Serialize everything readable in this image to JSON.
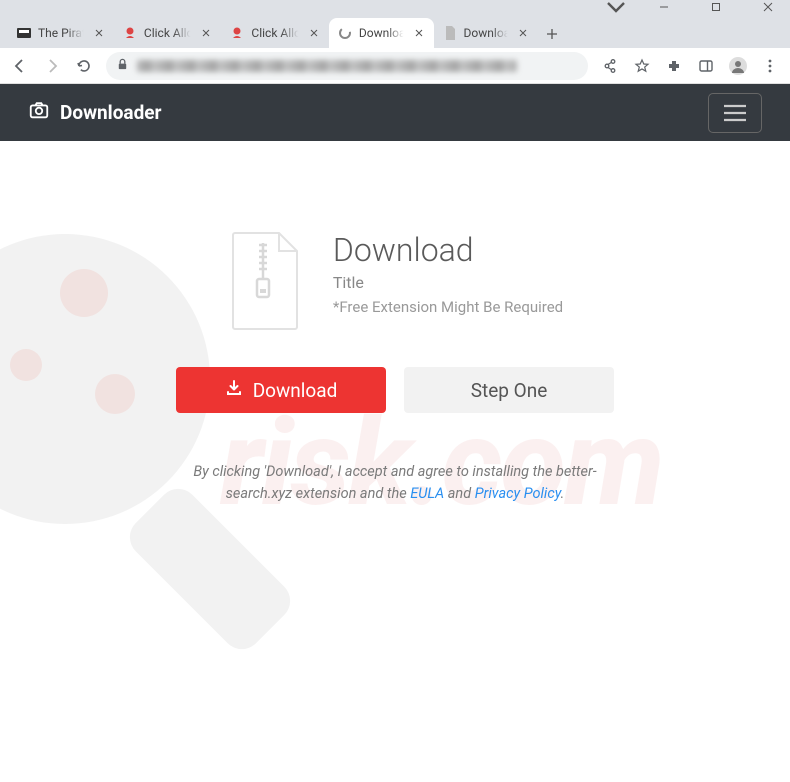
{
  "browser": {
    "tabs": [
      {
        "title": "The Pirat"
      },
      {
        "title": "Click Allo"
      },
      {
        "title": "Click Allo"
      },
      {
        "title": "Downloa"
      },
      {
        "title": "Downloa"
      }
    ],
    "active_tab_index": 3
  },
  "navbar": {
    "brand": "Downloader"
  },
  "hero": {
    "heading": "Download",
    "subtitle": "Title",
    "note": "*Free Extension Might Be Required"
  },
  "buttons": {
    "primary": "Download",
    "secondary": "Step One"
  },
  "disclaimer": {
    "pre": "By clicking 'Download', I accept and agree to installing the better-search.xyz extension and the ",
    "eula": "EULA",
    "mid": " and ",
    "privacy": "Privacy Policy",
    "post": "."
  },
  "watermark": {
    "text": "risk.com"
  },
  "colors": {
    "navbar_bg": "#353a40",
    "primary_btn": "#ed3432",
    "link": "#2a8ff0"
  }
}
